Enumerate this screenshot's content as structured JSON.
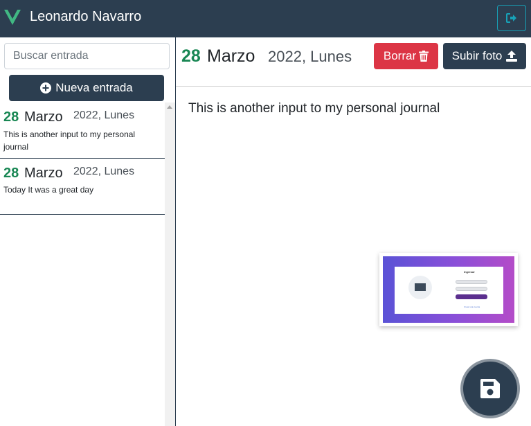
{
  "navbar": {
    "user_name": "Leonardo Navarro",
    "logo_icon": "vue-logo-icon",
    "logout_icon": "sign-out-icon",
    "brand_color": "#2c3e50",
    "logo_color": "#41b883"
  },
  "sidebar": {
    "search_placeholder": "Buscar entrada",
    "new_entry_label": "Nueva entrada",
    "new_entry_icon": "plus-circle-icon",
    "entries": [
      {
        "day": "28",
        "month": "Marzo",
        "year_weekday": "2022, Lunes",
        "text": "This is another input to my personal journal"
      },
      {
        "day": "28",
        "month": "Marzo",
        "year_weekday": "2022, Lunes",
        "text": "Today It was a great day"
      }
    ]
  },
  "main": {
    "day": "28",
    "month": "Marzo",
    "year_weekday": "2022, Lunes",
    "delete_label": "Borrar",
    "delete_icon": "trash-icon",
    "upload_label": "Subir foto",
    "upload_icon": "upload-icon",
    "body": "This is another input to my personal journal",
    "image": {
      "title": "Ingresar",
      "link": "Crear una cuenta"
    },
    "save_icon": "floppy-disk-icon",
    "colors": {
      "day": "#198754",
      "danger": "#dc3545"
    }
  }
}
